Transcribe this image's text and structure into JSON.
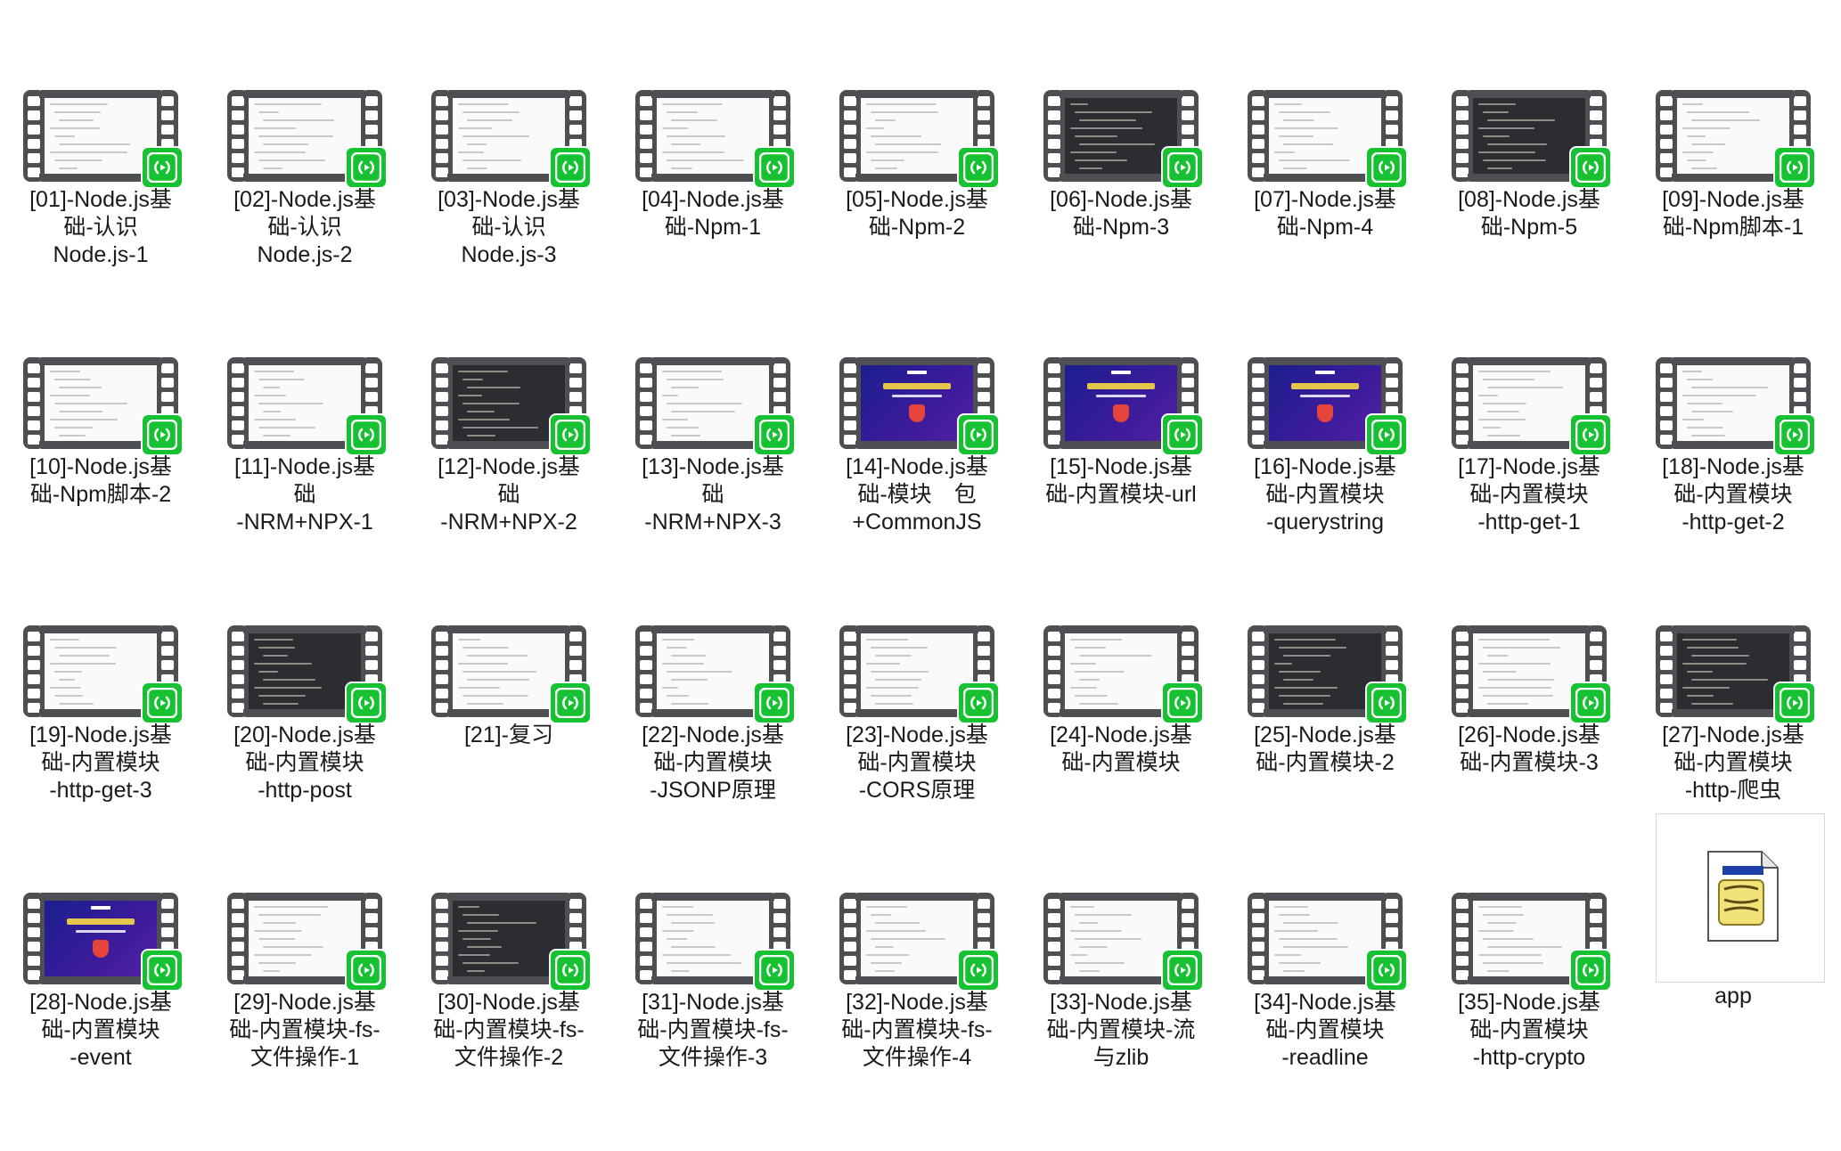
{
  "files": [
    {
      "name": "[01]-Node.js基础-认识Node.js-1",
      "label": "[01]-Node.js基\n础-认识\nNode.js-1",
      "thumb": "light"
    },
    {
      "name": "[02]-Node.js基础-认识Node.js-2",
      "label": "[02]-Node.js基\n础-认识\nNode.js-2",
      "thumb": "light"
    },
    {
      "name": "[03]-Node.js基础-认识Node.js-3",
      "label": "[03]-Node.js基\n础-认识\nNode.js-3",
      "thumb": "light"
    },
    {
      "name": "[04]-Node.js基础-Npm-1",
      "label": "[04]-Node.js基\n础-Npm-1",
      "thumb": "light"
    },
    {
      "name": "[05]-Node.js基础-Npm-2",
      "label": "[05]-Node.js基\n础-Npm-2",
      "thumb": "light"
    },
    {
      "name": "[06]-Node.js基础-Npm-3",
      "label": "[06]-Node.js基\n础-Npm-3",
      "thumb": "dark"
    },
    {
      "name": "[07]-Node.js基础-Npm-4",
      "label": "[07]-Node.js基\n础-Npm-4",
      "thumb": "light"
    },
    {
      "name": "[08]-Node.js基础-Npm-5",
      "label": "[08]-Node.js基\n础-Npm-5",
      "thumb": "dark"
    },
    {
      "name": "[09]-Node.js基础-Npm脚本-1",
      "label": "[09]-Node.js基\n础-Npm脚本-1",
      "thumb": "light"
    },
    {
      "name": "[10]-Node.js基础-Npm脚本-2",
      "label": "[10]-Node.js基\n础-Npm脚本-2",
      "thumb": "light"
    },
    {
      "name": "[11]-Node.js基础-NRM+NPX-1",
      "label": "[11]-Node.js基\n础\n-NRM+NPX-1",
      "thumb": "light"
    },
    {
      "name": "[12]-Node.js基础-NRM+NPX-2",
      "label": "[12]-Node.js基\n础\n-NRM+NPX-2",
      "thumb": "dark"
    },
    {
      "name": "[13]-Node.js基础-NRM+NPX-3",
      "label": "[13]-Node.js基\n础\n-NRM+NPX-3",
      "thumb": "light"
    },
    {
      "name": "[14]-Node.js基础-模块 包+CommonJS",
      "label": "[14]-Node.js基\n础-模块　包\n+CommonJS",
      "thumb": "banner"
    },
    {
      "name": "[15]-Node.js基础-内置模块-url",
      "label": "[15]-Node.js基\n础-内置模块-url",
      "thumb": "banner"
    },
    {
      "name": "[16]-Node.js基础-内置模块-querystring",
      "label": "[16]-Node.js基\n础-内置模块\n-querystring",
      "thumb": "banner"
    },
    {
      "name": "[17]-Node.js基础-内置模块-http-get-1",
      "label": "[17]-Node.js基\n础-内置模块\n-http-get-1",
      "thumb": "light"
    },
    {
      "name": "[18]-Node.js基础-内置模块-http-get-2",
      "label": "[18]-Node.js基\n础-内置模块\n-http-get-2",
      "thumb": "light"
    },
    {
      "name": "[19]-Node.js基础-内置模块-http-get-3",
      "label": "[19]-Node.js基\n础-内置模块\n-http-get-3",
      "thumb": "light"
    },
    {
      "name": "[20]-Node.js基础-内置模块-http-post",
      "label": "[20]-Node.js基\n础-内置模块\n-http-post",
      "thumb": "dark"
    },
    {
      "name": "[21]-复习",
      "label": "[21]-复习",
      "thumb": "light"
    },
    {
      "name": "[22]-Node.js基础-内置模块-JSONP原理",
      "label": "[22]-Node.js基\n础-内置模块\n-JSONP原理",
      "thumb": "light"
    },
    {
      "name": "[23]-Node.js基础-内置模块-CORS原理",
      "label": "[23]-Node.js基\n础-内置模块\n-CORS原理",
      "thumb": "light"
    },
    {
      "name": "[24]-Node.js基础-内置模块",
      "label": "[24]-Node.js基\n础-内置模块",
      "thumb": "light"
    },
    {
      "name": "[25]-Node.js基础-内置模块-2",
      "label": "[25]-Node.js基\n础-内置模块-2",
      "thumb": "dark"
    },
    {
      "name": "[26]-Node.js基础-内置模块-3",
      "label": "[26]-Node.js基\n础-内置模块-3",
      "thumb": "light"
    },
    {
      "name": "[27]-Node.js基础-内置模块-http-爬虫",
      "label": "[27]-Node.js基\n础-内置模块\n-http-爬虫",
      "thumb": "dark"
    },
    {
      "name": "[28]-Node.js基础-内置模块-event",
      "label": "[28]-Node.js基\n础-内置模块\n-event",
      "thumb": "banner"
    },
    {
      "name": "[29]-Node.js基础-内置模块-fs-文件操作-1",
      "label": "[29]-Node.js基\n础-内置模块-fs-\n文件操作-1",
      "thumb": "light"
    },
    {
      "name": "[30]-Node.js基础-内置模块-fs-文件操作-2",
      "label": "[30]-Node.js基\n础-内置模块-fs-\n文件操作-2",
      "thumb": "dark"
    },
    {
      "name": "[31]-Node.js基础-内置模块-fs-文件操作-3",
      "label": "[31]-Node.js基\n础-内置模块-fs-\n文件操作-3",
      "thumb": "light"
    },
    {
      "name": "[32]-Node.js基础-内置模块-fs-文件操作-4",
      "label": "[32]-Node.js基\n础-内置模块-fs-\n文件操作-4",
      "thumb": "light"
    },
    {
      "name": "[33]-Node.js基础-内置模块-流与zlib",
      "label": "[33]-Node.js基\n础-内置模块-流\n与zlib",
      "thumb": "light"
    },
    {
      "name": "[34]-Node.js基础-内置模块-readline",
      "label": "[34]-Node.js基\n础-内置模块\n-readline",
      "thumb": "light"
    },
    {
      "name": "[35]-Node.js基础-内置模块-http-crypto",
      "label": "[35]-Node.js基\n础-内置模块\n-http-crypto",
      "thumb": "light"
    }
  ],
  "doc_file": {
    "label": "app",
    "icon": "script-document-icon"
  },
  "icons": {
    "video_badge": "video-player-badge-icon",
    "film": "film-strip-icon"
  },
  "colors": {
    "badge": "#17c232",
    "film": "#4e4f52",
    "banner": "#3a1b9a"
  }
}
